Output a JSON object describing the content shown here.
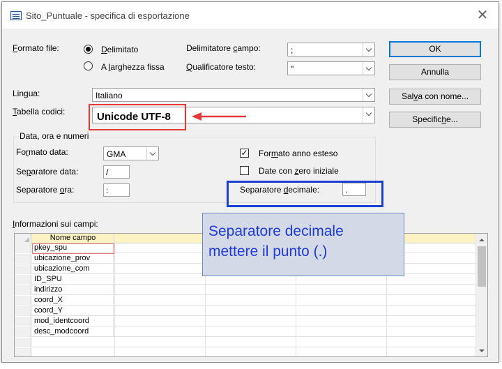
{
  "window": {
    "title": "Sito_Puntuale - specifica di esportazione",
    "close_glyph": "✕"
  },
  "format": {
    "label_pre": "",
    "label_u": "F",
    "label_post": "ormato file:",
    "delimited": {
      "label_pre": "",
      "label_u": "D",
      "label_post": "elimitato",
      "selected": true
    },
    "fixed": {
      "label_pre": "A ",
      "label_u": "l",
      "label_post": "arghezza fissa",
      "selected": false
    }
  },
  "field_delimiter": {
    "label_pre": "Delimitatore ",
    "label_u": "c",
    "label_post": "ampo:",
    "value": ";"
  },
  "text_qualifier": {
    "label_pre": "",
    "label_u": "Q",
    "label_post": "ualificatore testo:",
    "value": "\""
  },
  "language": {
    "label_pre": "Lin",
    "label_u": "g",
    "label_post": "ua:",
    "value": "Italiano"
  },
  "codepage": {
    "label_pre": "",
    "label_u": "T",
    "label_post": "abella codici:",
    "value": "Unicode UTF-8"
  },
  "buttons": {
    "ok": "OK",
    "cancel": "Annulla",
    "save_as": {
      "pre": "Sal",
      "u": "v",
      "post": "a con nome..."
    },
    "specs": {
      "pre": "Specific",
      "u": "h",
      "post": "e..."
    }
  },
  "datetime_group": {
    "title": "Data, ora e numeri",
    "date_format": {
      "label_pre": "Fo",
      "label_u": "r",
      "label_post": "mato data:",
      "value": "GMA"
    },
    "date_separator": {
      "label_pre": "Se",
      "label_u": "p",
      "label_post": "aratore data:",
      "value": "/"
    },
    "time_separator": {
      "label_pre": "Separatore ",
      "label_u": "o",
      "label_post": "ra:",
      "value": ":"
    },
    "four_digit_year": {
      "label_pre": "For",
      "label_u": "m",
      "label_post": "ato anno esteso",
      "checked": true
    },
    "leading_zeros": {
      "label_pre": "Date con ",
      "label_u": "z",
      "label_post": "ero iniziale",
      "checked": false
    },
    "decimal_separator": {
      "label_pre": "Separatore ",
      "label_u": "d",
      "label_post": "ecimale:",
      "value": "."
    }
  },
  "fields_info": {
    "label_pre": "",
    "label_u": "I",
    "label_post": "nformazioni sui campi:",
    "header": "Nome campo",
    "rows": [
      "pkey_spu",
      "ubicazione_prov",
      "ubicazione_com",
      "ID_SPU",
      "indirizzo",
      "coord_X",
      "coord_Y",
      "mod_identcoord",
      "desc_modcoord"
    ]
  },
  "annotation": {
    "callout_line1": "Separatore decimale",
    "callout_line2": "mettere il punto (.)",
    "colors": {
      "red": "#e53935",
      "blue": "#1a3fd1",
      "callout_bg": "#d3d9e6"
    }
  }
}
